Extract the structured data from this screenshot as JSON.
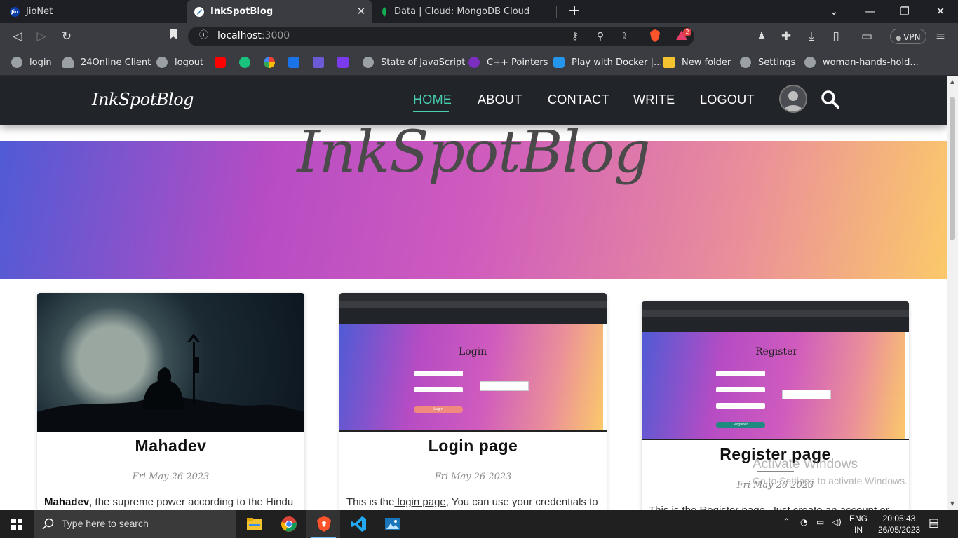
{
  "browser": {
    "tabs": [
      {
        "label": "JioNet",
        "active": false
      },
      {
        "label": "InkSpotBlog",
        "active": true
      },
      {
        "label": "Data | Cloud: MongoDB Cloud",
        "active": false
      }
    ],
    "url_host": "localhost",
    "url_port": ":3000",
    "notification_count": "2",
    "vpn_label": "VPN",
    "bookmarks": [
      {
        "label": "login",
        "icon": "globe-icon"
      },
      {
        "label": "24Online Client",
        "icon": "cloud-icon"
      },
      {
        "label": "logout",
        "icon": "globe-icon"
      },
      {
        "label": "",
        "icon": "youtube-icon"
      },
      {
        "label": "",
        "icon": "chatgpt-icon"
      },
      {
        "label": "",
        "icon": "google-icon"
      },
      {
        "label": "",
        "icon": "s-icon"
      },
      {
        "label": "",
        "icon": "code-icon"
      },
      {
        "label": "",
        "icon": "bolt-icon"
      },
      {
        "label": "State of JavaScript",
        "icon": "globe-icon"
      },
      {
        "label": "C++ Pointers",
        "icon": "p-icon"
      },
      {
        "label": "Play with Docker |...",
        "icon": "docker-icon"
      },
      {
        "label": "New folder",
        "icon": "folder-icon"
      },
      {
        "label": "Settings",
        "icon": "gear-icon"
      },
      {
        "label": "woman-hands-hold...",
        "icon": "globe-icon"
      }
    ]
  },
  "site": {
    "logo": "InkSpotBlog",
    "nav": [
      {
        "label": "HOME",
        "active": true
      },
      {
        "label": "ABOUT",
        "active": false
      },
      {
        "label": "CONTACT",
        "active": false
      },
      {
        "label": "WRITE",
        "active": false
      },
      {
        "label": "LOGOUT",
        "active": false
      }
    ],
    "hero_title": "InkSpotBlog",
    "posts": [
      {
        "title": "Mahadev",
        "date": "Fri May 26 2023",
        "excerpt_bold": "Mahadev",
        "excerpt_rest": ", the supreme power according to the Hindu"
      },
      {
        "title": "Login page",
        "date": "Fri May 26 2023",
        "excerpt_pre": "This is the",
        "excerpt_link": " login page",
        "excerpt_rest": ", You can use your credentials to",
        "thumb_heading": "Login",
        "thumb_button": "Login"
      },
      {
        "title": "Register page",
        "date": "Fri May 26 2023",
        "excerpt_pre": "This is the Register page. Just create an account or use",
        "thumb_heading": "Register",
        "thumb_button": "Register"
      }
    ]
  },
  "watermark": {
    "line1": "Activate Windows",
    "line2": "Go to Settings to activate Windows."
  },
  "taskbar": {
    "search_placeholder": "Type here to search",
    "lang_top": "ENG",
    "lang_bottom": "IN",
    "time": "20:05:43",
    "date": "26/05/2023"
  },
  "colors": {
    "accent": "#47d1b0",
    "nav_bg": "#212429",
    "hero_gradient": [
      "#4f5bd5",
      "#b64cc4",
      "#cf5bbe",
      "#ea8f9a",
      "#fbc96a"
    ]
  }
}
